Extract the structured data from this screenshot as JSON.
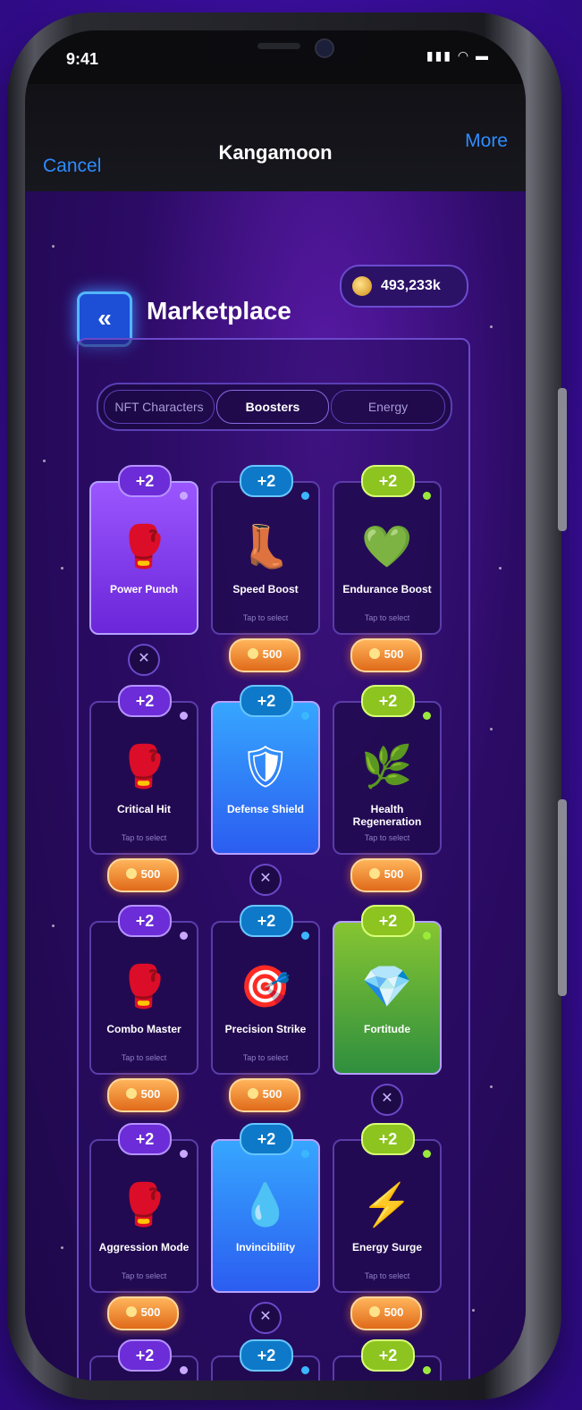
{
  "status": {
    "time": "9:41",
    "icons": "▮▮▮ ◠ ▬"
  },
  "navbar": {
    "cancel": "Cancel",
    "title": "Kangamoon",
    "more": "More"
  },
  "header": {
    "back_icon": "«",
    "title": "Marketplace",
    "coins": "493,233k"
  },
  "tabs": [
    "NFT Characters",
    "Boosters",
    "Energy"
  ],
  "tap_label": "Tap to select",
  "cards": [
    {
      "name": "Power Punch",
      "badge": "+2",
      "color": "purple",
      "selected": true,
      "icon": "🥊"
    },
    {
      "name": "Speed Boost",
      "badge": "+2",
      "color": "blue",
      "selected": false,
      "icon": "👢",
      "price": "500"
    },
    {
      "name": "Endurance Boost",
      "badge": "+2",
      "color": "green",
      "selected": false,
      "icon": "💚",
      "price": "500"
    },
    {
      "name": "Critical Hit",
      "badge": "+2",
      "color": "purple",
      "selected": false,
      "icon": "🥊",
      "price": "500"
    },
    {
      "name": "Defense Shield",
      "badge": "+2",
      "color": "blue",
      "selected": true,
      "icon": "🛡"
    },
    {
      "name": "Health Regeneration",
      "badge": "+2",
      "color": "green",
      "selected": false,
      "icon": "🌿",
      "price": "500"
    },
    {
      "name": "Combo Master",
      "badge": "+2",
      "color": "purple",
      "selected": false,
      "icon": "🥊",
      "price": "500"
    },
    {
      "name": "Precision Strike",
      "badge": "+2",
      "color": "blue",
      "selected": false,
      "icon": "🎯",
      "price": "500"
    },
    {
      "name": "Fortitude",
      "badge": "+2",
      "color": "green",
      "selected": true,
      "icon": "💎"
    },
    {
      "name": "Aggression Mode",
      "badge": "+2",
      "color": "purple",
      "selected": false,
      "icon": "🥊",
      "price": "500"
    },
    {
      "name": "Invincibility",
      "badge": "+2",
      "color": "blue",
      "selected": true,
      "icon": "💧"
    },
    {
      "name": "Energy Surge",
      "badge": "+2",
      "color": "green",
      "selected": false,
      "icon": "⚡",
      "price": "500"
    },
    {
      "name": "",
      "badge": "+2",
      "color": "purple",
      "selected": false,
      "icon": ""
    },
    {
      "name": "",
      "badge": "+2",
      "color": "blue",
      "selected": false,
      "icon": ""
    },
    {
      "name": "",
      "badge": "+2",
      "color": "green",
      "selected": false,
      "icon": ""
    }
  ],
  "x_label": "✕",
  "colors": {
    "accent_blue": "#2f8cff",
    "purple": "#6c2cd8",
    "blue": "#0e79c9",
    "green": "#8dc420",
    "price": "#e06a1a"
  }
}
